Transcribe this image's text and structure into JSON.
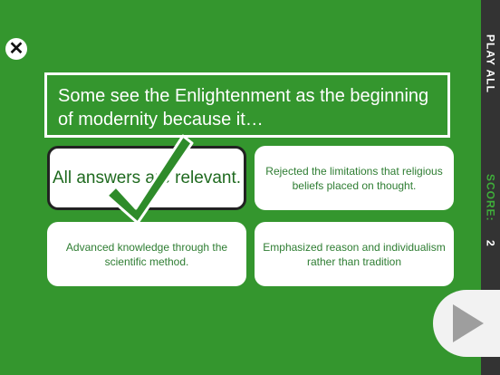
{
  "close_icon": "close-icon",
  "question": "Some see the Enlightenment as the beginning of modernity because it…",
  "answers": [
    {
      "label": "All answers are relevant.",
      "selected": true
    },
    {
      "label": "Rejected the limitations that religious beliefs placed on thought."
    },
    {
      "label": "Advanced knowledge through the scientific method."
    },
    {
      "label": "Emphasized reason and individualism rather than tradition"
    }
  ],
  "sidebar": {
    "play_all": "PLAY ALL",
    "score_label": "SCORE:",
    "score_value": "2"
  },
  "colors": {
    "background": "#34962e",
    "panel": "#333333",
    "accent": "#3fae3a",
    "check": "#2e8b2a"
  },
  "icons": {
    "check": "checkmark-icon",
    "next": "play-arrow-icon"
  }
}
